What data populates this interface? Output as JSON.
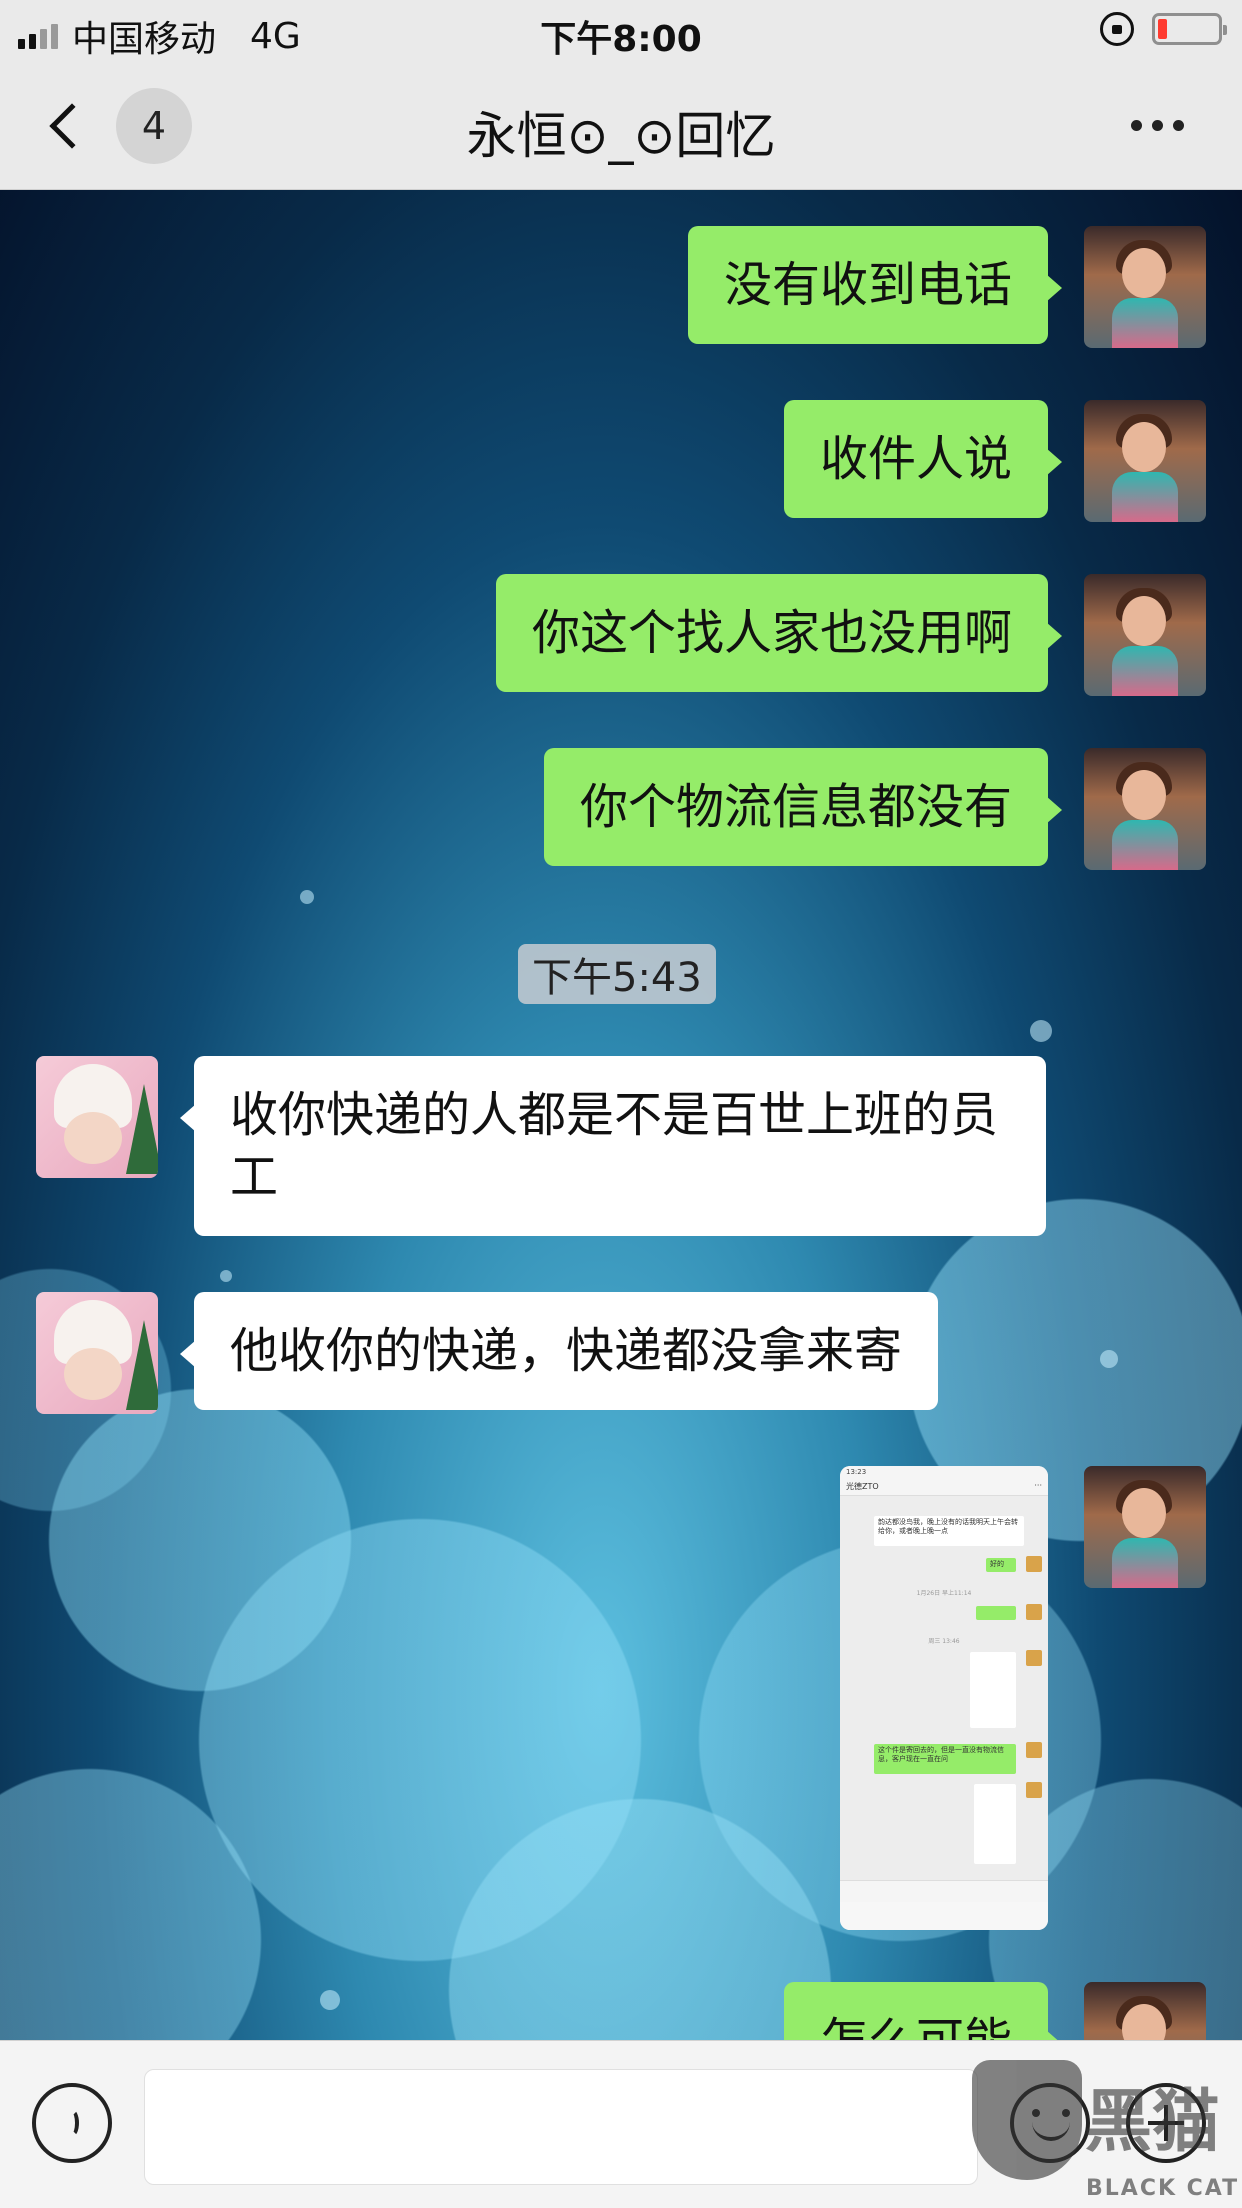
{
  "status_bar": {
    "carrier": "中国移动",
    "network": "4G",
    "time": "下午8:00",
    "battery_level": 0.15,
    "battery_color": "#ff3b30"
  },
  "nav": {
    "back_icon": "chevron-left-icon",
    "unread_count": "4",
    "title": "永恒⊙_⊙回忆",
    "more_icon": "more-icon"
  },
  "messages": [
    {
      "side": "right",
      "type": "text",
      "text": "没有收到电话"
    },
    {
      "side": "right",
      "type": "text",
      "text": "收件人说"
    },
    {
      "side": "right",
      "type": "text",
      "text": "你这个找人家也没用啊"
    },
    {
      "side": "right",
      "type": "text",
      "text": "你个物流信息都没有"
    },
    {
      "side": "left",
      "type": "text",
      "text": "收你快递的人都是不是百世上班的员工"
    },
    {
      "side": "left",
      "type": "text",
      "text": "他收你的快递，快递都没拿来寄"
    },
    {
      "side": "right",
      "type": "image"
    },
    {
      "side": "right",
      "type": "text",
      "text": "怎么可能"
    }
  ],
  "timestamp": "下午5:43",
  "thumbnail": {
    "status_time": "13:23",
    "title": "光德ZTO",
    "msg1": "韵达都没鸟我，晚上没有的话我明天上午会转给你，或者晚上晚一点",
    "msg2": "好的",
    "sys1": "1月26日 早上11:14",
    "sys2": "周三 13:46",
    "msg3": "这个件是寄回去的，但是一直没有物流信息，客户现在一直在问"
  },
  "input_bar": {
    "voice_icon": "voice-icon",
    "text_value": "",
    "emoji_icon": "emoji-icon",
    "plus_icon": "plus-icon"
  },
  "watermark": {
    "text_cn": "黑猫",
    "text_en": "BLACK CAT"
  },
  "colors": {
    "my_bubble": "#95ec69",
    "their_bubble": "#ffffff",
    "bar_background": "#eaeaea"
  }
}
